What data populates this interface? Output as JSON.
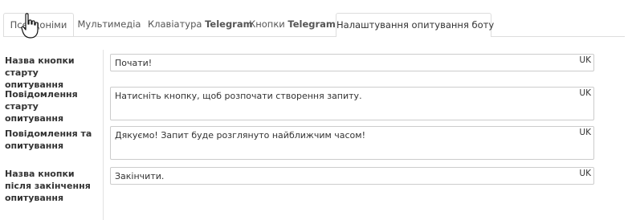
{
  "tabs": [
    {
      "label": "Псевдоніми",
      "active": false
    },
    {
      "label": "Мультимедіа",
      "active": false
    },
    {
      "label_prefix": "Клавіатура ",
      "label_bold": "Telegram",
      "active": false
    },
    {
      "label_prefix": "Кнопки ",
      "label_bold": "Telegram",
      "active": false
    },
    {
      "label": "Налаштування опитування боту",
      "active": true
    }
  ],
  "fields": [
    {
      "label": "Назва кнопки старту опитування",
      "value": "Почати!",
      "lang": "UK"
    },
    {
      "label": "Повідомлення старту опитування",
      "value": "Натисніть кнопку, щоб розпочати створення запиту.",
      "lang": "UK"
    },
    {
      "label": "Повідомлення та опитування",
      "value": "Дякуємо! Запит буде розглянуто найближчим часом!",
      "lang": "UK"
    },
    {
      "label": "Назва кнопки після закінчення опитування",
      "value": "Закінчити.",
      "lang": "UK"
    }
  ],
  "icons": {
    "cursor": "hand-pointer-icon"
  },
  "colors": {
    "border": "#dddddd",
    "label_text": "#333333",
    "tab_text": "#555555"
  }
}
